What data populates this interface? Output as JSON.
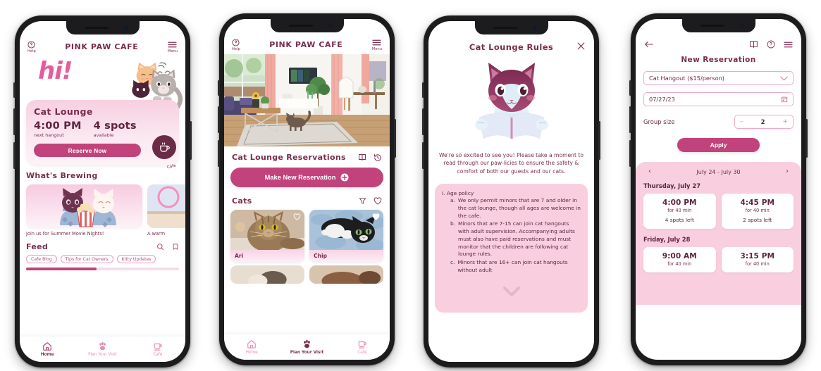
{
  "brand": {
    "name": "PINK PAW CAFE",
    "accent": "#c2437c",
    "plum": "#7b2d4e",
    "card_pink": "#f9cfe0"
  },
  "phone1": {
    "header": {
      "help_label": "Help",
      "menu_label": "Menu",
      "title": "PINK PAW CAFE"
    },
    "greeting": "hi!",
    "lounge_card": {
      "title": "Cat Lounge",
      "time_value": "4:00 PM",
      "time_caption": "next hangout",
      "spots_value": "4 spots",
      "spots_caption": "available",
      "reserve_label": "Reserve Now",
      "cafe_fab_label": "Cafe"
    },
    "brewing": {
      "title": "What's Brewing",
      "cards": [
        {
          "caption": "Join us for Summer Movie Nights!"
        },
        {
          "caption": "A warm"
        }
      ]
    },
    "feed": {
      "title": "Feed",
      "chips": [
        "Cafe Blog",
        "Tips for Cat Owners",
        "Kitty Updates"
      ]
    },
    "tabs": [
      {
        "label": "Home",
        "icon": "home-icon",
        "active": true
      },
      {
        "label": "Plan Your Visit",
        "icon": "paw-icon",
        "active": false
      },
      {
        "label": "Café",
        "icon": "cup-icon",
        "active": false
      }
    ]
  },
  "phone2": {
    "header": {
      "help_label": "Help",
      "menu_label": "Menu",
      "title": "PINK PAW CAFE"
    },
    "reservations": {
      "title": "Cat Lounge Reservations",
      "make_new_label": "Make New Reservation"
    },
    "cats": {
      "title": "Cats",
      "items": [
        {
          "name": "Ari",
          "favorited": false
        },
        {
          "name": "Chip",
          "favorited": true
        }
      ]
    },
    "tabs": [
      {
        "label": "Home",
        "icon": "home-icon",
        "active": false
      },
      {
        "label": "Plan Your Visit",
        "icon": "paw-icon",
        "active": true
      },
      {
        "label": "Café",
        "icon": "cup-icon",
        "active": false
      }
    ]
  },
  "phone3": {
    "title": "Cat Lounge Rules",
    "intro": "We're so excited to see you!  Please take a moment to read through our paw-licies to ensure the safety & comfort of both our guests and our cats.",
    "rules": [
      {
        "marker": "I.",
        "text": "Age policy",
        "level": 1
      },
      {
        "marker": "a.",
        "text": "We only permit minors that are 7 and older in the cat lounge, though all ages are welcome in the cafe.",
        "level": 2
      },
      {
        "marker": "b.",
        "text": "Minors that are 7-15 can join cat hangouts with adult supervision. Accompanying adults must also have paid reservations and must monitor that the children are following cat lounge rules.",
        "level": 2
      },
      {
        "marker": "c.",
        "text": "Minors that are 16+ can join cat hangouts without adult",
        "level": 2
      }
    ]
  },
  "phone4": {
    "title": "New Reservation",
    "type_field": {
      "value": "Cat Hangout ($15/person)"
    },
    "date_field": {
      "value": "07/27/23"
    },
    "group_size": {
      "label": "Group size",
      "value": "2",
      "minus": "–",
      "plus": "+"
    },
    "apply_label": "Apply",
    "week_range": "July 24 - July 30",
    "days": [
      {
        "label": "Thursday, July 27",
        "slots": [
          {
            "time": "4:00 PM",
            "duration": "for 40 min",
            "spots": "4 spots left"
          },
          {
            "time": "4:45 PM",
            "duration": "for 40 min",
            "spots": "2 spots left"
          }
        ]
      },
      {
        "label": "Friday, July 28",
        "slots": [
          {
            "time": "9:00 AM",
            "duration": "for 40 min",
            "spots": ""
          },
          {
            "time": "3:15 PM",
            "duration": "for 40 min",
            "spots": ""
          }
        ]
      }
    ]
  }
}
